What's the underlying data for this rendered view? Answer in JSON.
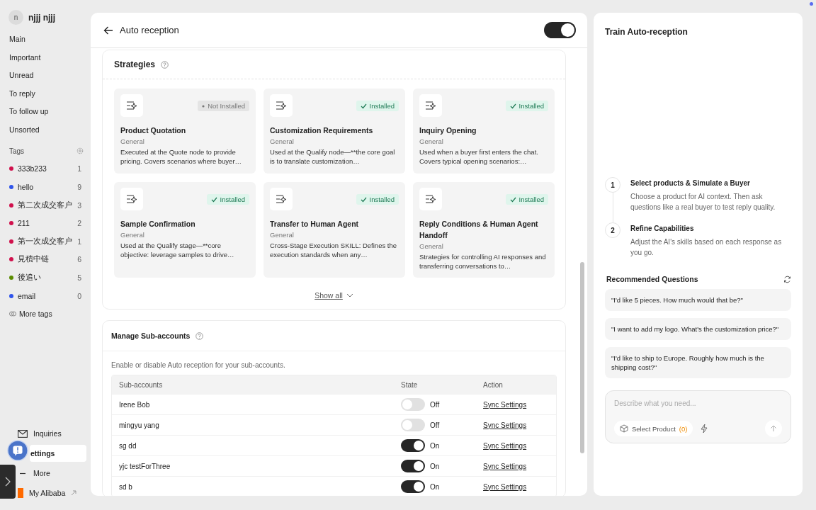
{
  "sidebar": {
    "user": {
      "avatar_letter": "n",
      "name": "njjj njjj"
    },
    "folders": [
      {
        "label": "Main"
      },
      {
        "label": "Important"
      },
      {
        "label": "Unread"
      },
      {
        "label": "To reply"
      },
      {
        "label": "To follow up"
      },
      {
        "label": "Unsorted"
      }
    ],
    "tags_title": "Tags",
    "tags": [
      {
        "name": "333b233",
        "count": "1",
        "color": "#d0104c"
      },
      {
        "name": "hello",
        "count": "9",
        "color": "#2f54eb"
      },
      {
        "name": "第二次成交客户",
        "count": "3",
        "color": "#d0104c"
      },
      {
        "name": "211",
        "count": "2",
        "color": "#d0104c"
      },
      {
        "name": "第一次成交客户",
        "count": "1",
        "color": "#d0104c"
      },
      {
        "name": "見積中链",
        "count": "6",
        "color": "#d0104c"
      },
      {
        "name": "後追い",
        "count": "5",
        "color": "#5b8c00"
      },
      {
        "name": "email",
        "count": "0",
        "color": "#2f54eb"
      }
    ],
    "more_tags": "More tags",
    "bottom_items": [
      {
        "kind": "mail",
        "label": "Inquiries",
        "selected": false
      },
      {
        "kind": "settings",
        "label": "ettings",
        "selected": true
      },
      {
        "kind": "more",
        "label": "More",
        "selected": false
      },
      {
        "kind": "alibaba",
        "label": "My Alibaba",
        "selected": false
      }
    ]
  },
  "main": {
    "title": "Auto reception",
    "enabled": true,
    "strategies": {
      "title": "Strategies",
      "items": [
        {
          "title": "Product Quotation",
          "category": "General",
          "description": "Executed at the Quote node to provide pricing. Covers scenarios where buyer…",
          "installed": false,
          "status": "Not Installed"
        },
        {
          "title": "Customization Requirements",
          "category": "General",
          "description": "Used at the Qualify node—**the core goal is to translate customization…",
          "installed": true,
          "status": "Installed"
        },
        {
          "title": "Inquiry Opening",
          "category": "General",
          "description": "Used when a buyer first enters the chat. Covers typical opening scenarios:…",
          "installed": true,
          "status": "Installed"
        },
        {
          "title": "Sample Confirmation",
          "category": "General",
          "description": "Used at the Qualify stage—**core objective: leverage samples to drive…",
          "installed": true,
          "status": "Installed"
        },
        {
          "title": "Transfer to Human Agent",
          "category": "General",
          "description": "Cross-Stage Execution SKILL: Defines the execution standards when any…",
          "installed": true,
          "status": "Installed"
        },
        {
          "title": "Reply Conditions & Human Agent Handoff",
          "category": "General",
          "description": "Strategies for controlling AI responses and transferring conversations to…",
          "installed": true,
          "status": "Installed"
        }
      ],
      "show_all": "Show all"
    },
    "sub_accounts": {
      "title": "Manage Sub-accounts",
      "description": "Enable or disable Auto reception for your sub-accounts.",
      "columns": [
        "Sub-accounts",
        "State",
        "Action"
      ],
      "rows": [
        {
          "name": "Irene Bob",
          "on": false,
          "state": "Off",
          "action": "Sync Settings"
        },
        {
          "name": "mingyu yang",
          "on": false,
          "state": "Off",
          "action": "Sync Settings"
        },
        {
          "name": "sg dd",
          "on": true,
          "state": "On",
          "action": "Sync Settings"
        },
        {
          "name": "yjc testForThree",
          "on": true,
          "state": "On",
          "action": "Sync Settings"
        },
        {
          "name": "sd b",
          "on": true,
          "state": "On",
          "action": "Sync Settings"
        }
      ]
    }
  },
  "trainer": {
    "title": "Train Auto-reception",
    "steps": [
      {
        "number": "1",
        "title": "Select products & Simulate a Buyer",
        "text": "Choose a product for AI context. Then ask questions like a real buyer to test reply quality."
      },
      {
        "number": "2",
        "title": "Refine Capabilities",
        "text": "Adjust the AI's skills based on each response as you go."
      }
    ],
    "recommended_title": "Recommended Questions",
    "questions": [
      "\"I'd like 5 pieces. How much would that be?\"",
      "\"I want to add my logo. What's the customization price?\"",
      "\"I'd like to ship to Europe. Roughly how much is the shipping cost?\""
    ],
    "input": {
      "placeholder": "Describe what you need..."
    },
    "select_product": "Select Product",
    "product_count": "(0)"
  }
}
